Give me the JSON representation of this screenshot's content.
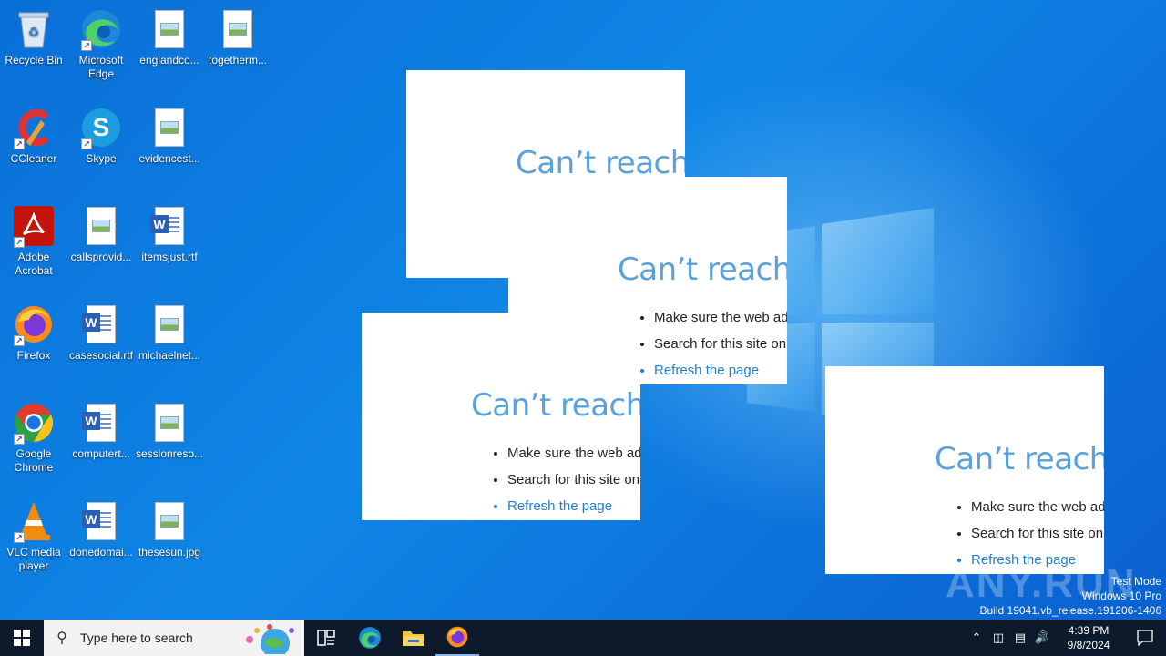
{
  "desktop": {
    "icons": [
      {
        "label": "Recycle Bin"
      },
      {
        "label": "Microsoft Edge"
      },
      {
        "label": "englandco..."
      },
      {
        "label": "togetherm..."
      },
      {
        "label": "CCleaner"
      },
      {
        "label": "Skype"
      },
      {
        "label": "evidencest..."
      },
      {
        "label": "Adobe Acrobat"
      },
      {
        "label": "callsprovid..."
      },
      {
        "label": "itemsjust.rtf"
      },
      {
        "label": "Firefox"
      },
      {
        "label": "casesocial.rtf"
      },
      {
        "label": "michaelnet..."
      },
      {
        "label": "Google Chrome"
      },
      {
        "label": "computert..."
      },
      {
        "label": "sessionreso..."
      },
      {
        "label": "VLC media player"
      },
      {
        "label": "donedomai..."
      },
      {
        "label": "thesesun.jpg"
      }
    ]
  },
  "error_windows": [
    {
      "title": "Can’t reach t",
      "items": []
    },
    {
      "title": "Can’t reach t",
      "items": [
        "Make sure the web ad",
        "Search for this site on",
        "Refresh the page"
      ]
    },
    {
      "title": "Can’t reach t",
      "items": [
        "Make sure the web ad",
        "Search for this site on",
        "Refresh the page"
      ]
    },
    {
      "title": "Can’t reach t",
      "items": [
        "Make sure the web ad",
        "Search for this site on",
        "Refresh the page"
      ]
    }
  ],
  "watermark": {
    "line1": "Test Mode",
    "line2": "Windows 10 Pro",
    "line3": "Build 19041.vb_release.191206-1406",
    "brand": "ANY.RUN"
  },
  "taskbar": {
    "search_placeholder": "Type here to search",
    "time": "4:39 PM",
    "date": "9/8/2024"
  },
  "colors": {
    "desktop_blue": "#0a6fd8",
    "error_title": "#5aa2db",
    "link": "#1f7ed3",
    "taskbar": "#0c1a2c"
  }
}
